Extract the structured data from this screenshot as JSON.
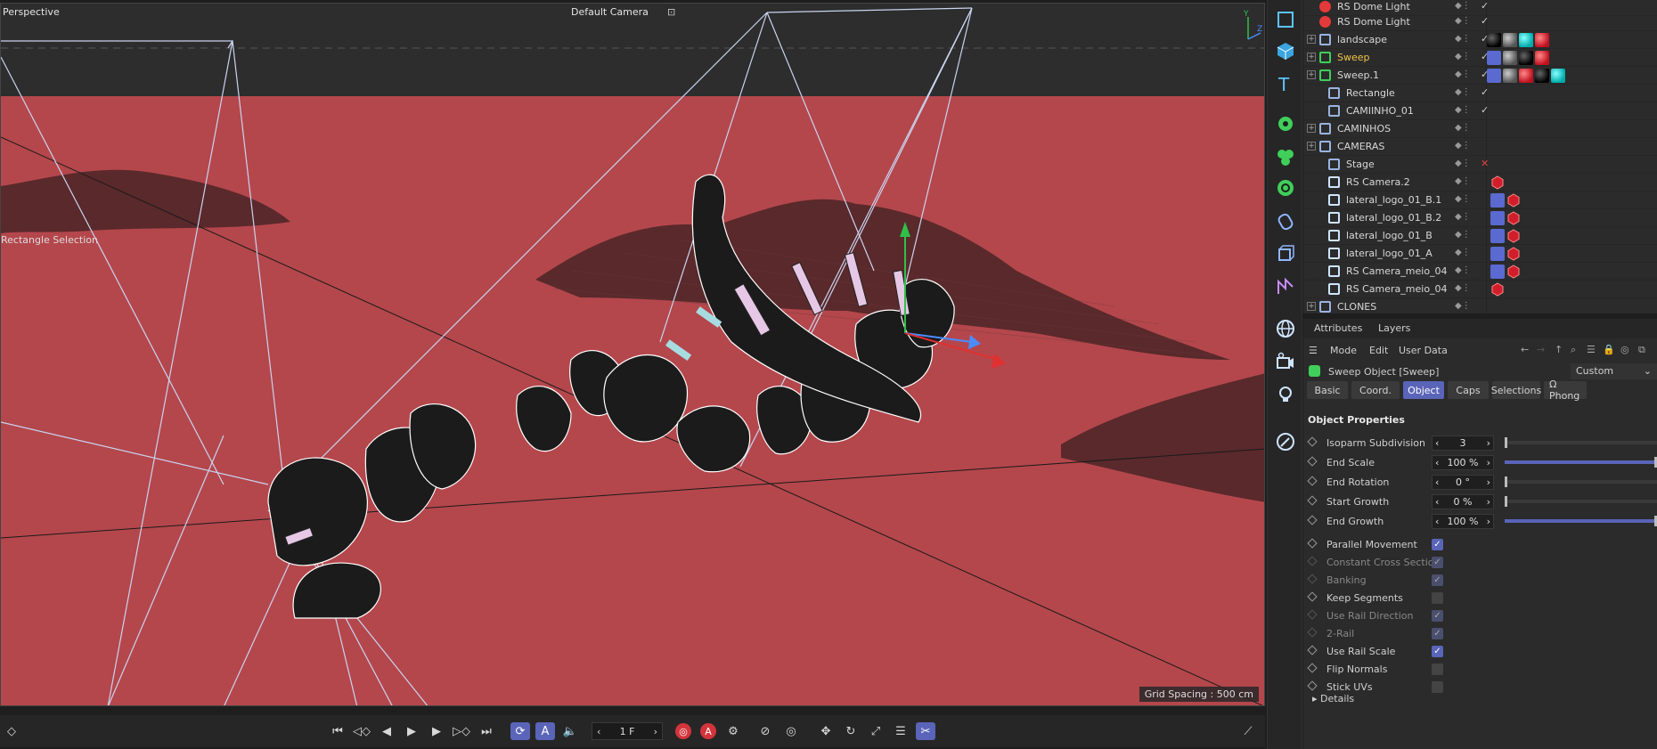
{
  "viewport": {
    "mode": "Perspective",
    "camera": "Default Camera",
    "camera_icon": "camera-lock-icon",
    "selection_tool": "Rectangle Selection",
    "grid_spacing": "Grid Spacing : 500 cm",
    "background_color": "#b4474c"
  },
  "timeline": {
    "frame": "1 F"
  },
  "object_manager": {
    "rows": [
      {
        "name": "RS Dome Light",
        "icon": "rs-light-icon"
      },
      {
        "name": "RS Dome Light",
        "icon": "rs-light-icon"
      },
      {
        "name": "landscape",
        "icon": "layer-icon"
      },
      {
        "name": "Sweep",
        "icon": "sweep-icon",
        "highlight": true
      },
      {
        "name": "Sweep.1",
        "icon": "sweep-icon"
      },
      {
        "name": "Rectangle",
        "icon": "spline-icon"
      },
      {
        "name": "CAMIINHO_01",
        "icon": "spline-icon"
      },
      {
        "name": "CAMINHOS",
        "icon": "layer-icon"
      },
      {
        "name": "CAMERAS",
        "icon": "layer-icon"
      },
      {
        "name": "Stage",
        "icon": "stage-icon"
      },
      {
        "name": "RS Camera.2",
        "icon": "camera-icon"
      },
      {
        "name": "lateral_logo_01_B.1",
        "icon": "camera-icon"
      },
      {
        "name": "lateral_logo_01_B.2",
        "icon": "camera-icon"
      },
      {
        "name": "lateral_logo_01_B",
        "icon": "camera-icon"
      },
      {
        "name": "lateral_logo_01_A",
        "icon": "camera-icon"
      },
      {
        "name": "RS Camera_meio_04",
        "icon": "camera-icon"
      },
      {
        "name": "RS Camera_meio_04",
        "icon": "camera-icon"
      },
      {
        "name": "CLONES",
        "icon": "layer-icon"
      }
    ]
  },
  "attributes": {
    "tabs": [
      "Attributes",
      "Layers"
    ],
    "menu": [
      "Mode",
      "Edit",
      "User Data"
    ],
    "object_title": "Sweep Object [Sweep]",
    "preset": "Custom",
    "subtabs": [
      "Basic",
      "Coord.",
      "Object",
      "Caps",
      "Selections",
      "Ω Phong"
    ],
    "active_subtab": "Object",
    "section_title": "Object Properties",
    "numeric_props": [
      {
        "label": "Isoparm Subdivision",
        "value": "3",
        "fraction": 0.0
      },
      {
        "label": "End Scale",
        "value": "100 %",
        "fraction": 1.0
      },
      {
        "label": "End Rotation",
        "value": "0 °",
        "fraction": 0.0
      },
      {
        "label": "Start Growth",
        "value": "0 %",
        "fraction": 0.0
      },
      {
        "label": "End Growth",
        "value": "100 %",
        "fraction": 1.0
      }
    ],
    "check_props": [
      {
        "label": "Parallel Movement",
        "checked": true,
        "enabled": true
      },
      {
        "label": "Constant Cross Section",
        "checked": true,
        "enabled": false
      },
      {
        "label": "Banking",
        "checked": true,
        "enabled": false
      },
      {
        "label": "Keep Segments",
        "checked": false,
        "enabled": true
      },
      {
        "label": "Use Rail Direction",
        "checked": true,
        "enabled": false
      },
      {
        "label": "2-Rail",
        "checked": true,
        "enabled": false
      },
      {
        "label": "Use Rail Scale",
        "checked": true,
        "enabled": true
      },
      {
        "label": "Flip Normals",
        "checked": false,
        "enabled": true
      },
      {
        "label": "Stick UVs",
        "checked": false,
        "enabled": true
      }
    ],
    "details": "Details"
  }
}
